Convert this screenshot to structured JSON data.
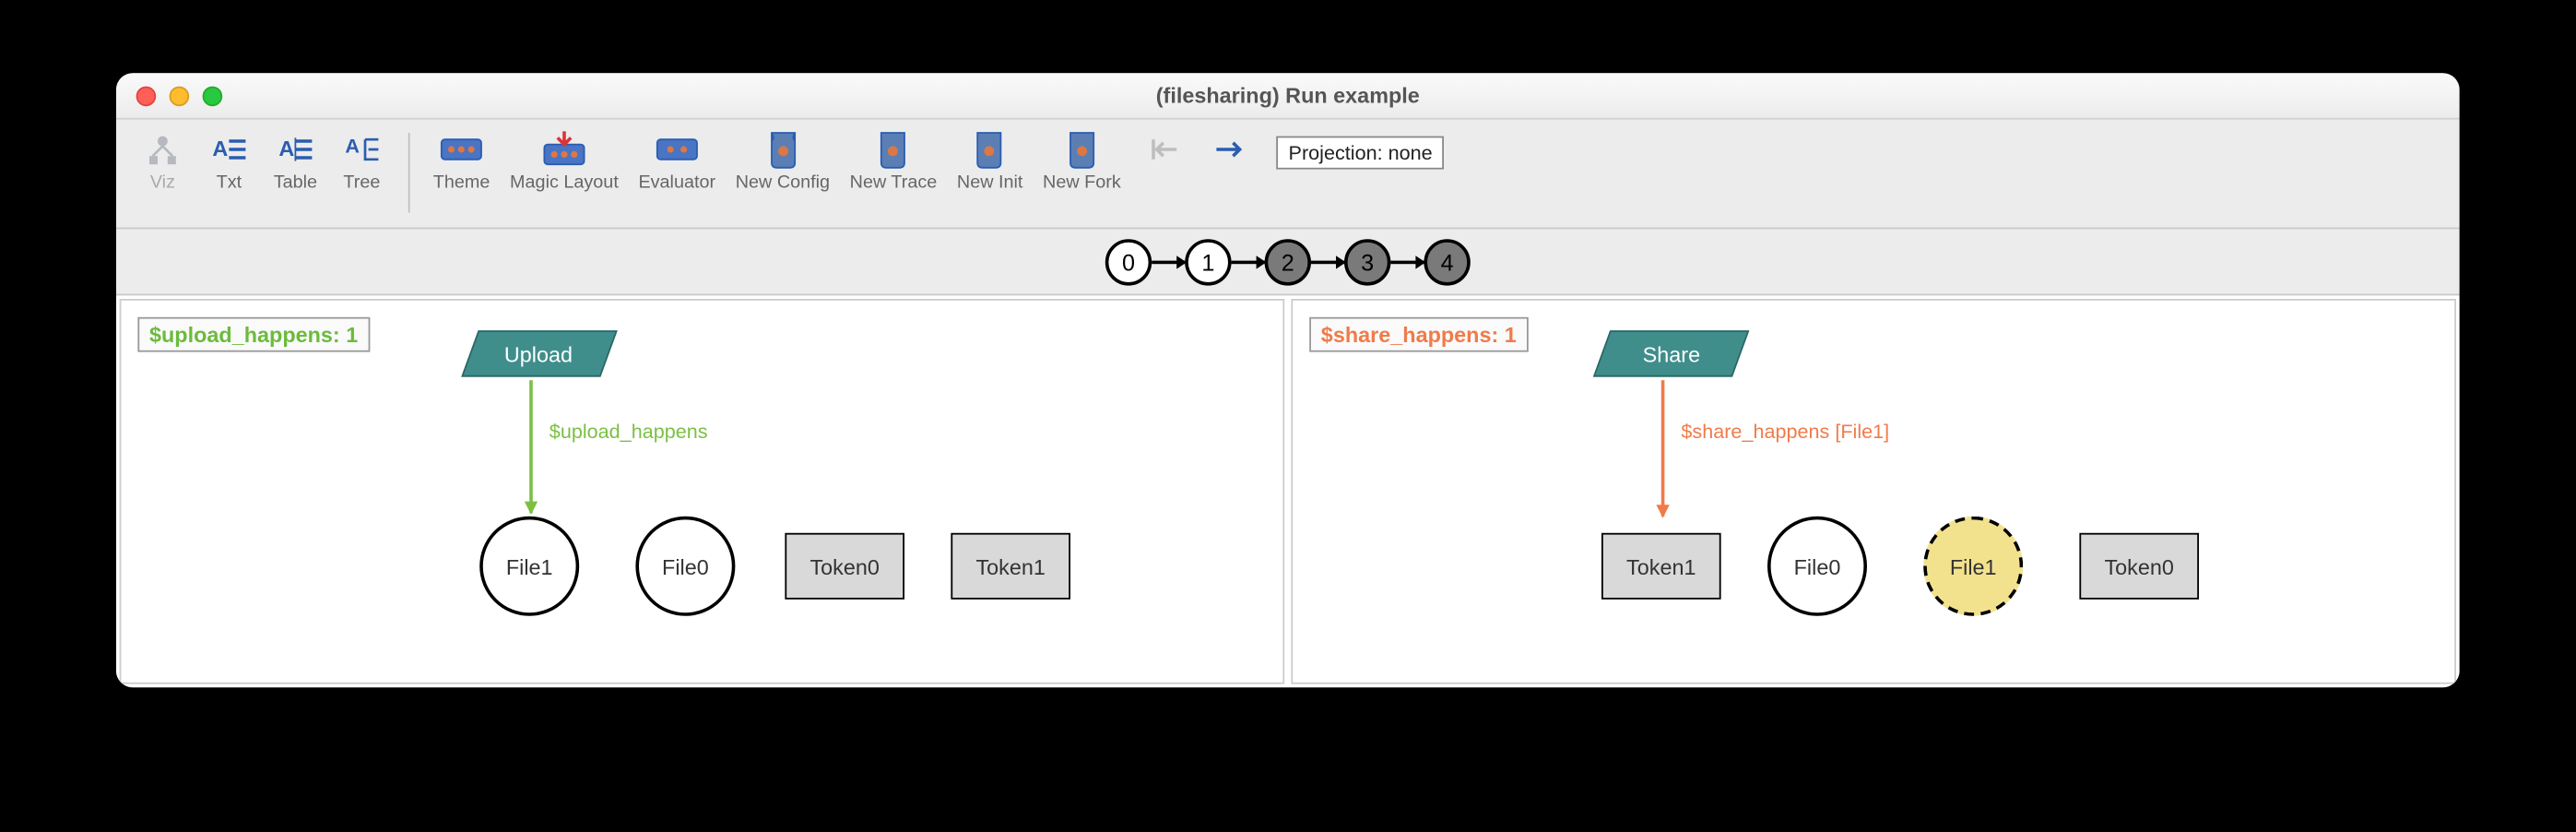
{
  "window": {
    "title": "(filesharing) Run example"
  },
  "toolbar": {
    "viz": "Viz",
    "txt": "Txt",
    "table": "Table",
    "tree": "Tree",
    "theme": "Theme",
    "magic_layout": "Magic Layout",
    "evaluator": "Evaluator",
    "new_config": "New Config",
    "new_trace": "New Trace",
    "new_init": "New Init",
    "new_fork": "New Fork",
    "prev": "←",
    "next": "→",
    "projection": "Projection: none"
  },
  "trace": {
    "states": [
      "0",
      "1",
      "2",
      "3",
      "4"
    ],
    "current": 1,
    "dark_from": 2,
    "loop_at": 4
  },
  "left": {
    "badge": "$upload_happens: 1",
    "event": "Upload",
    "edge_label": "$upload_happens",
    "nodes": {
      "file1": "File1",
      "file0": "File0",
      "token0": "Token0",
      "token1": "Token1"
    }
  },
  "right": {
    "badge": "$share_happens: 1",
    "event": "Share",
    "edge_label": "$share_happens [File1]",
    "nodes": {
      "token1": "Token1",
      "file0": "File0",
      "file1": "File1",
      "token0": "Token0"
    }
  }
}
